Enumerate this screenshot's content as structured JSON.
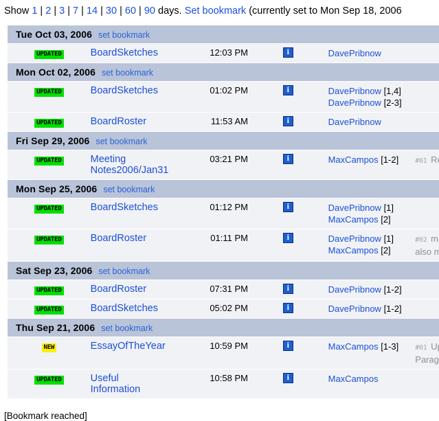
{
  "header": {
    "show_label": "Show",
    "day_options": [
      "1",
      "2",
      "3",
      "7",
      "14",
      "30",
      "60",
      "90"
    ],
    "separator": "|",
    "days_label": "days.",
    "set_bookmark_label": "Set bookmark",
    "bookmark_note": "(currently set to Mon Sep 18, 2006"
  },
  "set_bookmark_label": "set bookmark",
  "icons": {
    "info": "info-icon",
    "updated_badge": "UPDATED",
    "new_badge": "NEW"
  },
  "colors": {
    "link": "#1a4fd6",
    "day_header_bg": "#b9c4d9",
    "row_bg": "#f1f2f6",
    "updated_badge_bg": "#00e000",
    "new_badge_bg": "#ffee00",
    "info_icon_bg": "#1d5fd0",
    "comment_text": "#8d8f96"
  },
  "days": [
    {
      "date": "Tue Oct 03, 2006",
      "entries": [
        {
          "flag": "UPDATED",
          "flag_type": "updated",
          "page": "BoardSketches",
          "time": "12:03 PM",
          "authors": [
            {
              "name": "DavePribnow",
              "revs": ""
            }
          ],
          "comments": []
        }
      ]
    },
    {
      "date": "Mon Oct 02, 2006",
      "entries": [
        {
          "flag": "UPDATED",
          "flag_type": "updated",
          "page": "BoardSketches",
          "time": "01:02 PM",
          "authors": [
            {
              "name": "DavePribnow",
              "revs": " [1,4]"
            },
            {
              "name": "DavePribnow",
              "revs": " [2-3]"
            }
          ],
          "comments": []
        },
        {
          "flag": "UPDATED",
          "flag_type": "updated",
          "page": "BoardRoster",
          "time": "11:53 AM",
          "authors": [
            {
              "name": "DavePribnow",
              "revs": ""
            }
          ],
          "comments": []
        }
      ]
    },
    {
      "date": "Fri Sep 29, 2006",
      "entries": [
        {
          "flag": "UPDATED",
          "flag_type": "updated",
          "page": "Meeting Notes2006/Jan31",
          "time": "03:21 PM",
          "authors": [
            {
              "name": "MaxCampos",
              "revs": " [1-2]"
            }
          ],
          "comments": [
            {
              "num": "#01",
              "text": "Rever"
            }
          ]
        }
      ]
    },
    {
      "date": "Mon Sep 25, 2006",
      "entries": [
        {
          "flag": "UPDATED",
          "flag_type": "updated",
          "page": "BoardSketches",
          "time": "01:12 PM",
          "authors": [
            {
              "name": "DavePribnow",
              "revs": " [1]"
            },
            {
              "name": "MaxCampos",
              "revs": " [2]"
            }
          ],
          "comments": []
        },
        {
          "flag": "UPDATED",
          "flag_type": "updated",
          "page": "BoardRoster",
          "time": "01:11 PM",
          "authors": [
            {
              "name": "DavePribnow",
              "revs": " [1]"
            },
            {
              "name": "MaxCampos",
              "revs": " [2]"
            }
          ],
          "comments": [
            {
              "num": "#02",
              "text": "makin"
            },
            {
              "num": "",
              "text": "also minor"
            }
          ]
        }
      ]
    },
    {
      "date": "Sat Sep 23, 2006",
      "entries": [
        {
          "flag": "UPDATED",
          "flag_type": "updated",
          "page": "BoardRoster",
          "time": "07:31 PM",
          "authors": [
            {
              "name": "DavePribnow",
              "revs": " [1-2]"
            }
          ],
          "comments": []
        },
        {
          "flag": "UPDATED",
          "flag_type": "updated",
          "page": "BoardSketches",
          "time": "05:02 PM",
          "authors": [
            {
              "name": "DavePribnow",
              "revs": " [1-2]"
            }
          ],
          "comments": []
        }
      ]
    },
    {
      "date": "Thu Sep 21, 2006",
      "entries": [
        {
          "flag": "NEW",
          "flag_type": "new",
          "page": "EssayOfTheYear",
          "time": "10:59 PM",
          "authors": [
            {
              "name": "MaxCampos",
              "revs": " [1-3]"
            }
          ],
          "comments": [
            {
              "num": "#01",
              "text": "Uploa"
            },
            {
              "num": "",
              "text": "Paraguay."
            }
          ]
        },
        {
          "flag": "UPDATED",
          "flag_type": "updated",
          "page": "Useful Information",
          "time": "10:58 PM",
          "authors": [
            {
              "name": "MaxCampos",
              "revs": ""
            }
          ],
          "comments": []
        }
      ]
    }
  ],
  "footer": {
    "bookmark_reached": "[Bookmark reached]"
  }
}
